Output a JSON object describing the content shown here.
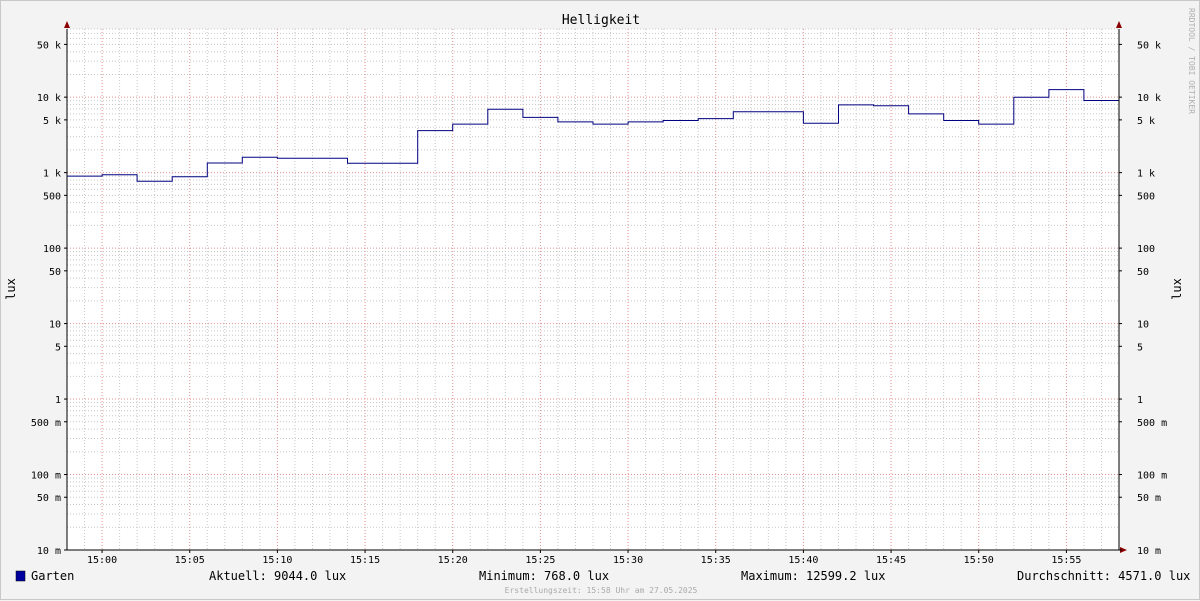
{
  "chart_data": {
    "type": "line",
    "title": "Helligkeit",
    "ylabel": "lux",
    "ylabel_right": "lux",
    "yscale": "log",
    "ylim": [
      0.01,
      80000
    ],
    "x_tick_labels": [
      "15:00",
      "15:05",
      "15:10",
      "15:15",
      "15:20",
      "15:25",
      "15:30",
      "15:35",
      "15:40",
      "15:45",
      "15:50",
      "15:55"
    ],
    "x_tick_minutes": [
      0,
      5,
      10,
      15,
      20,
      25,
      30,
      35,
      40,
      45,
      50,
      55
    ],
    "xlim_minutes": [
      -2,
      58
    ],
    "y_ticks": [
      {
        "value": 50000,
        "label": "50 k"
      },
      {
        "value": 10000,
        "label": "10 k"
      },
      {
        "value": 5000,
        "label": "5 k"
      },
      {
        "value": 1000,
        "label": "1 k"
      },
      {
        "value": 500,
        "label": "500"
      },
      {
        "value": 100,
        "label": "100"
      },
      {
        "value": 50,
        "label": "50"
      },
      {
        "value": 10,
        "label": "10"
      },
      {
        "value": 5,
        "label": "5"
      },
      {
        "value": 1,
        "label": "1"
      },
      {
        "value": 0.5,
        "label": "500 m"
      },
      {
        "value": 0.1,
        "label": "100 m"
      },
      {
        "value": 0.05,
        "label": "50 m"
      },
      {
        "value": 0.01,
        "label": "10 m"
      }
    ],
    "grid": true,
    "series": [
      {
        "name": "Garten",
        "color": "#000080",
        "step_start_minutes": [
          -2,
          0,
          2,
          4,
          6,
          8,
          10,
          14,
          18,
          20,
          22,
          24,
          26,
          28,
          30,
          32,
          34,
          36,
          40,
          42,
          44,
          46,
          48,
          50,
          52,
          54,
          56
        ],
        "step_end_minutes": [
          0,
          2,
          4,
          6,
          8,
          10,
          14,
          18,
          20,
          22,
          24,
          26,
          28,
          30,
          32,
          34,
          36,
          40,
          42,
          44,
          46,
          48,
          50,
          52,
          54,
          56,
          58
        ],
        "values": [
          900,
          940,
          768,
          880,
          1340,
          1600,
          1550,
          1330,
          3600,
          4400,
          6900,
          5400,
          4700,
          4400,
          4700,
          4900,
          5200,
          6400,
          4500,
          7900,
          7700,
          6000,
          4900,
          4400,
          10000,
          12599.2,
          9044
        ]
      }
    ]
  },
  "legend": {
    "series_name": "Garten",
    "swatch_color": "#0000a0",
    "aktuell": "Aktuell: 9044.0 lux",
    "minimum": "Minimum: 768.0 lux",
    "maximum": "Maximum: 12599.2 lux",
    "durchschnitt": "Durchschnitt: 4571.0 lux"
  },
  "footer": "Erstellungszeit: 15:58 Uhr am 27.05.2025",
  "watermark": "RRDTOOL / TOBI OETIKER",
  "colors": {
    "major_grid": "#e09090",
    "minor_grid": "#c8c8c8",
    "line": "#000080",
    "arrow": "#8b0000"
  }
}
